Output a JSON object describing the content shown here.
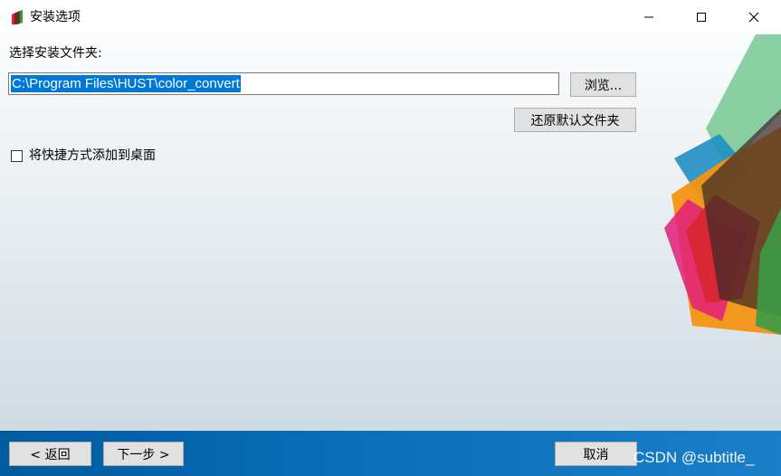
{
  "window": {
    "title": "安装选项",
    "controls": {
      "minimize_icon": "minimize-icon",
      "maximize_icon": "maximize-icon",
      "close_icon": "close-icon"
    }
  },
  "folder": {
    "label": "选择安装文件夹:",
    "path": "C:\\Program Files\\HUST\\color_convert",
    "browse_label": "浏览...",
    "restore_label": "还原默认文件夹"
  },
  "shortcut": {
    "label": "将快捷方式添加到桌面",
    "checked": false
  },
  "footer": {
    "back_label": "< 返回",
    "next_label": "下一步 >",
    "cancel_label": "取消",
    "watermark": "CSDN @subtitle_"
  },
  "colors": {
    "selection": "#0078d7",
    "footer_blue": "#005a9e",
    "button_face": "#e1e1e1"
  }
}
